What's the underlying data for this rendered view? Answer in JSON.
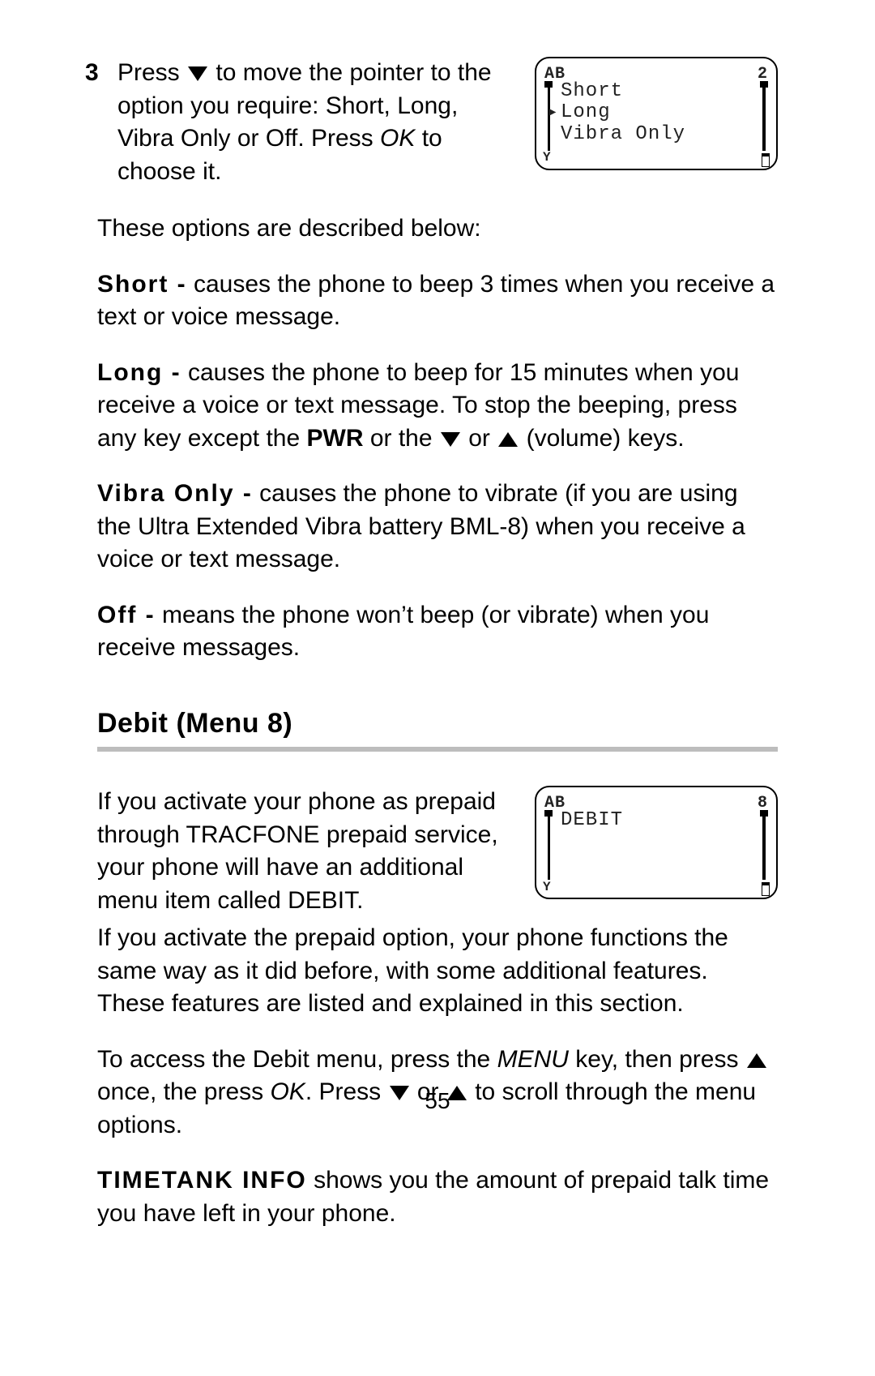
{
  "step3": {
    "num": "3",
    "pre": "Press ",
    "mid": " to move the pointer to the option you require: Short, Long, Vibra Only or Off. Press ",
    "ok": "OK",
    "post": " to choose it."
  },
  "lcd1": {
    "topLeft": "AB",
    "topRight": "2",
    "line1": "Short",
    "line2": "Long",
    "line3": "Vibra Only"
  },
  "intro_desc": "These options are described below:",
  "opt_short": {
    "label": "Short -",
    "text": "  causes the phone to beep 3 times when you receive a text or voice message."
  },
  "opt_long": {
    "label": "Long -",
    "text_a": "   causes the phone to beep for 15 minutes when you receive a voice or text message. To stop the beeping, press any key except the ",
    "pwr": "PWR",
    "text_b": " or the ",
    "text_c": " or ",
    "text_d": " (volume) keys."
  },
  "opt_vibra": {
    "label": "Vibra Only -",
    "text": "  causes the phone to vibrate (if you are using the Ultra Extended Vibra battery BML-8) when you receive a voice or text message."
  },
  "opt_off": {
    "label": "Off -",
    "text": "   means the phone won’t beep (or vibrate) when you receive messages."
  },
  "section_title": "Debit (Menu 8)",
  "debit_intro": "If you activate your phone as prepaid through TRACFONE prepaid service, your phone will have an additional menu item called DEBIT.",
  "lcd2": {
    "topLeft": "AB",
    "topRight": "8",
    "line1": "DEBIT"
  },
  "debit_p2": "If you activate the prepaid option, your phone functions the same way as it did before, with some additional features. These features are listed and explained in this section.",
  "debit_p3": {
    "a": "To access the Debit menu, press the ",
    "menu": "MENU",
    "b": " key, then press ",
    "c": " once, the press ",
    "ok": "OK",
    "d": ". Press ",
    "e": " or ",
    "f": " to scroll through the menu options."
  },
  "timetank": {
    "label": "TIMETANK INFO",
    "text": " shows you the amount of prepaid talk time you have left in your phone."
  },
  "page_number": "55"
}
